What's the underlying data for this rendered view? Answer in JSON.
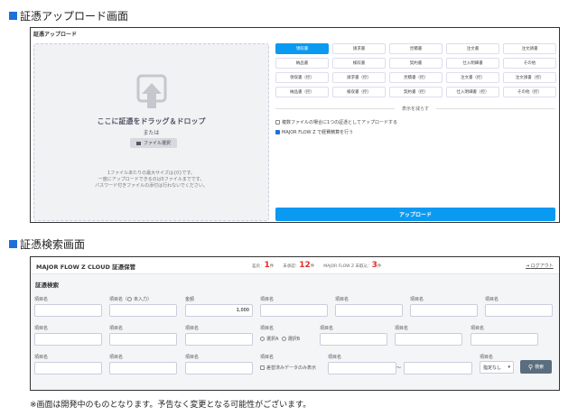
{
  "upload_section": {
    "title": "証憑アップロード画面",
    "panel_title": "証憑アップロード",
    "drop_text": "ここに証憑をドラッグ＆ドロップ",
    "or_text": "または",
    "file_select": "ファイル選択",
    "notes": [
      "1ファイルあたりの最大サイズは{0}です。",
      "一度にアップロードできるのは5ファイルまでです。",
      "パスワード付きファイルの添付は行わないでください。"
    ],
    "doc_types": [
      "領収書",
      "請求書",
      "見積書",
      "注文書",
      "注文請書",
      "納品書",
      "検収書",
      "契約書",
      "仕入明細書",
      "その他",
      "領収書（控）",
      "請求書（控）",
      "見積書（控）",
      "注文書（控）",
      "注文請書（控）",
      "納品書（控）",
      "検収書（控）",
      "契約書（控）",
      "仕入明細書（控）",
      "その他（控）"
    ],
    "show_less": "表示を減らす",
    "options": [
      {
        "label": "複数ファイルの場合に1つの証憑としてアップロードする",
        "checked": false
      },
      {
        "label": "MAJOR FLOW Z で経費精算を行う",
        "checked": true
      }
    ],
    "upload_button": "アップロード"
  },
  "search_section": {
    "title": "証憑検索画面",
    "app_title": "MAJOR FLOW Z CLOUD 証憑保管",
    "stats": [
      {
        "label": "差戻：",
        "count": "1",
        "unit": "件"
      },
      {
        "label": "未承認：",
        "count": "12",
        "unit": "件"
      },
      {
        "label": "MAJOR FLOW Z 未取込：",
        "count": "3",
        "unit": "件"
      }
    ],
    "logout": "ログアウト",
    "heading": "証憑検索",
    "field_label": "項目名",
    "unentered_label": "項目名（",
    "unentered_opt": "未入力）",
    "amount_label": "金額",
    "amount_value": "1,000",
    "radio_a": "選択A",
    "radio_b": "選択B",
    "approved_only": "差替済みデータのみ表示",
    "range_sep": "～",
    "select_value": "指定なし",
    "search_button": "検索"
  },
  "footer_note": "※画面は開発中のものとなります。予告なく変更となる可能性がございます。",
  "colors": {
    "accent": "#0a9af2",
    "title_square": "#1e6fd9",
    "stat_red": "#e52b2b",
    "search_btn": "#5b6e7f"
  }
}
